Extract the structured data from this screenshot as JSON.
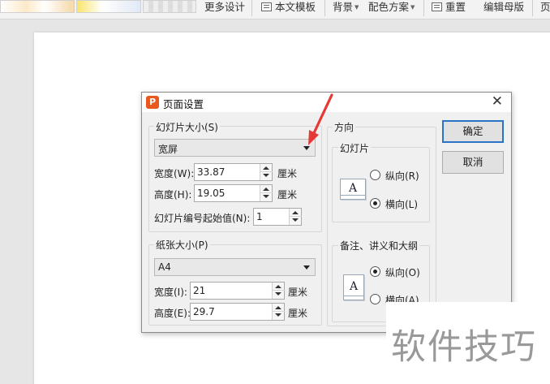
{
  "ribbon": {
    "more_design": "更多设计",
    "text_template": "本文模板",
    "background": "背景",
    "color_scheme": "配色方案",
    "reset": "重置",
    "edit_master": "编辑母版",
    "truncated": "页"
  },
  "dialog": {
    "title": "页面设置",
    "slide_size": {
      "group_label": "幻灯片大小(S)",
      "selected": "宽屏",
      "width_label": "宽度(W):",
      "width_value": "33.87",
      "height_label": "高度(H):",
      "height_value": "19.05",
      "unit": "厘米",
      "numbering_label": "幻灯片编号起始值(N):",
      "numbering_value": "1"
    },
    "paper_size": {
      "group_label": "纸张大小(P)",
      "selected": "A4",
      "width_label": "宽度(I):",
      "width_value": "21",
      "height_label": "高度(E):",
      "height_value": "29.7",
      "unit": "厘米"
    },
    "orientation": {
      "label": "方向",
      "slides": {
        "label": "幻灯片",
        "portrait": "纵向(R)",
        "landscape": "横向(L)",
        "selected": "landscape"
      },
      "notes": {
        "label": "备注、讲义和大纲",
        "portrait": "纵向(O)",
        "landscape": "横向(A)",
        "selected": "portrait"
      }
    },
    "ok_label": "确定",
    "cancel_label": "取消"
  },
  "watermark": "软件技巧",
  "colors": {
    "arrow": "#e53935",
    "accent": "#2b73c7",
    "app_icon": "#e8581f"
  }
}
